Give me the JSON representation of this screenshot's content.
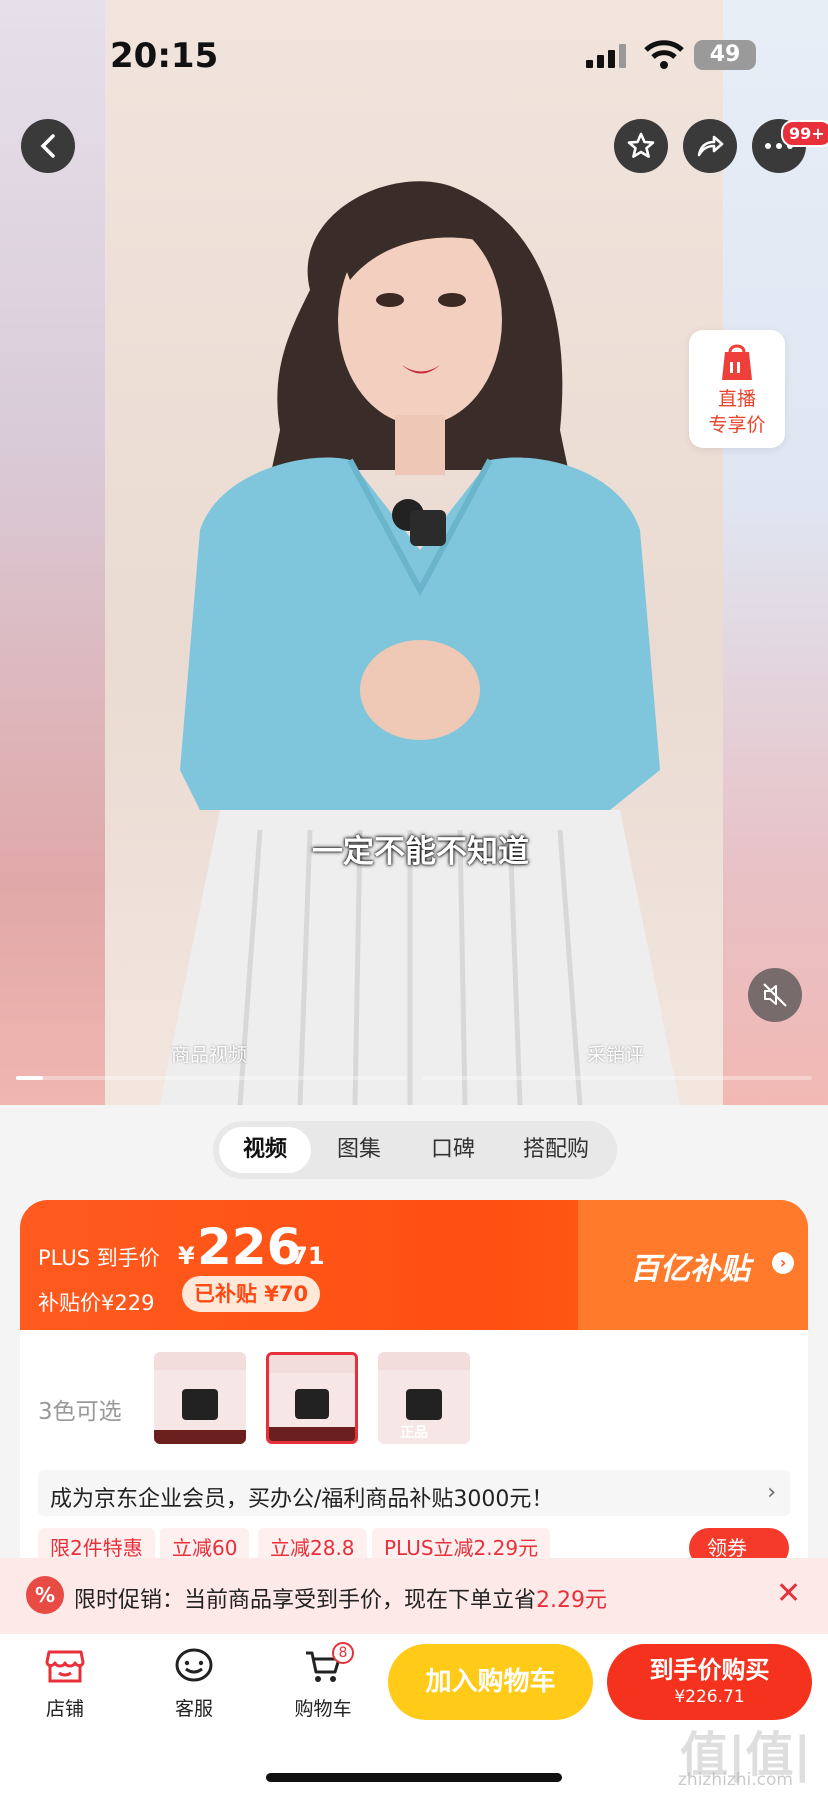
{
  "status": {
    "time": "20:15",
    "battery": "49"
  },
  "header": {
    "more_badge": "99+"
  },
  "live_card": {
    "line1": "直播",
    "line2": "专享价"
  },
  "video": {
    "subtitle": "一定不能不知道",
    "label_left": "商品视频",
    "label_right": "采销评",
    "progress": 0.07
  },
  "tabs": [
    "视频",
    "图集",
    "口碑",
    "搭配购"
  ],
  "price": {
    "plus_label": "PLUS 到手价",
    "currency": "¥",
    "integer": "226",
    "decimal": ".71",
    "subsidy_label": "补贴价¥229",
    "subsidy_chip": "已补贴 ¥70",
    "program": "百亿补贴"
  },
  "variants": {
    "label": "3色可选",
    "count": 3,
    "selected_index": 1,
    "tag": "正品"
  },
  "member": {
    "text": "成为京东企业会员，买办公/福利商品补贴3000元！",
    "chevron": "›"
  },
  "coupons": [
    "限2件特惠",
    "立减60",
    "立减28.8",
    "PLUS立减2.29元"
  ],
  "coupon_button": "领券",
  "promo": {
    "icon": "%",
    "text": "限时促销：当前商品享受到手价，现在下单立省",
    "amount": "2.29元"
  },
  "bottom": {
    "shop": "店铺",
    "service": "客服",
    "cart": "购物车",
    "cart_count": "8",
    "add_cart": "加入购物车",
    "buy_now": "到手价购买",
    "buy_price": "¥226.71"
  },
  "watermark": {
    "big": "值|值|值",
    "small": "zhizhizhi.com"
  },
  "colors": {
    "accent": "#ff5a1f",
    "cart_btn": "#ffcb18",
    "buy_btn": "#f5321e"
  }
}
